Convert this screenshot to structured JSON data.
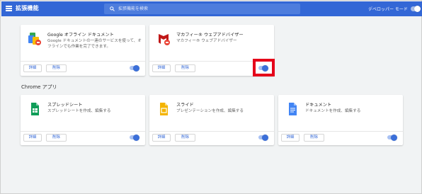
{
  "header": {
    "title": "拡張機能",
    "search_placeholder": "拡張機能を検索",
    "developer_mode_label": "デベロッパー モード",
    "developer_mode_on": false
  },
  "extensions": [
    {
      "name": "Google オフライン ドキュメント",
      "description": "Google ドキュメントの一連のサービスを使って、オフラインでも作業を完了できます。",
      "details_label": "詳細",
      "remove_label": "削除",
      "enabled": true,
      "icon": "google-offline-docs-icon"
    },
    {
      "name": "マカフィー® ウェブアドバイザー",
      "description": "マカフィー® ウェブアドバイザー",
      "details_label": "詳細",
      "remove_label": "削除",
      "enabled": true,
      "icon": "mcafee-icon"
    }
  ],
  "apps_section": {
    "title": "Chrome アプリ",
    "apps": [
      {
        "name": "スプレッドシート",
        "description": "スプレッドシートを作成、編集する",
        "details_label": "詳細",
        "remove_label": "削除",
        "enabled": true,
        "icon": "sheets-icon",
        "color": "#0f9d58"
      },
      {
        "name": "スライド",
        "description": "プレゼンテーションを作成、編集する",
        "details_label": "詳細",
        "remove_label": "削除",
        "enabled": true,
        "icon": "slides-icon",
        "color": "#f4b400"
      },
      {
        "name": "ドキュメント",
        "description": "ドキュメントを作成、編集する",
        "details_label": "詳細",
        "remove_label": "削除",
        "enabled": true,
        "icon": "docs-icon",
        "color": "#4285f4"
      }
    ]
  },
  "colors": {
    "header": "#3367d6",
    "accent": "#3b6fd9",
    "highlight": "#e5001a",
    "background": "#f1f3f4"
  }
}
